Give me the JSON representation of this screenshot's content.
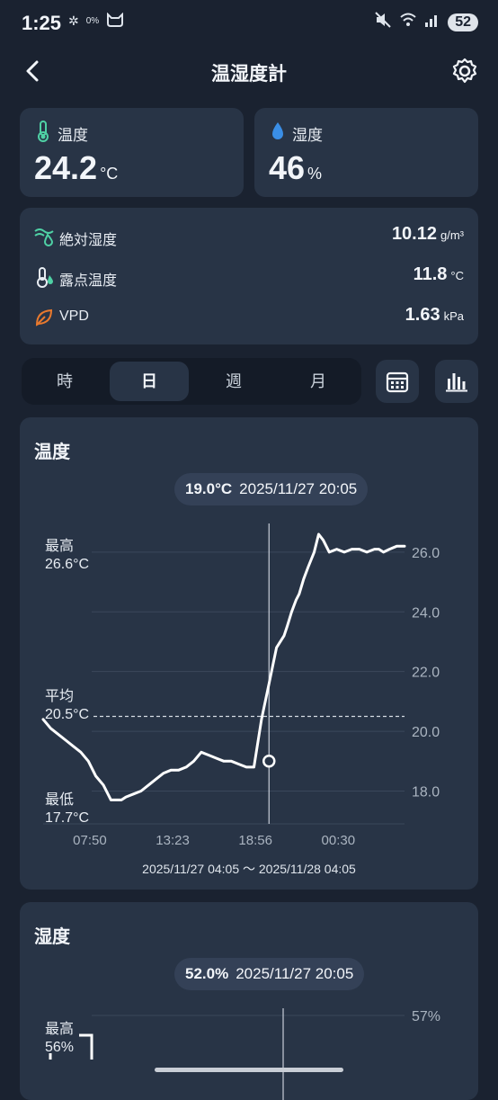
{
  "status": {
    "time": "1:25",
    "indicator": "0%",
    "battery": "52"
  },
  "appbar": {
    "title": "温湿度計"
  },
  "temp_card": {
    "label": "温度",
    "value": "24.2",
    "unit": "°C"
  },
  "hum_card": {
    "label": "湿度",
    "value": "46",
    "unit": "%"
  },
  "details": [
    {
      "label": "絶対湿度",
      "value": "10.12",
      "unit": "g/m³",
      "icon": "wind-water-icon"
    },
    {
      "label": "露点温度",
      "value": "11.8",
      "unit": "°C",
      "icon": "dew-point-icon"
    },
    {
      "label": "VPD",
      "value": "1.63",
      "unit": "kPa",
      "icon": "leaf-icon"
    }
  ],
  "tabs": [
    "時",
    "日",
    "週",
    "月"
  ],
  "active_tab": "日",
  "chart1": {
    "title": "温度",
    "pill_value": "19.0°C",
    "pill_time": "2025/11/27 20:05",
    "max_label": "最高",
    "max_value": "26.6°C",
    "avg_label": "平均",
    "avg_value": "20.5°C",
    "min_label": "最低",
    "min_value": "17.7°C",
    "range": "2025/11/27 04:05 ～ 2025/11/28 04:05"
  },
  "chart2": {
    "title": "湿度",
    "pill_value": "52.0%",
    "pill_time": "2025/11/27 20:05",
    "max_label": "最高",
    "max_value": "56%",
    "top_tick": "57%"
  },
  "chart_data": [
    {
      "type": "line",
      "title": "温度",
      "xlabel": "",
      "ylabel": "",
      "x_ticks": [
        "07:50",
        "13:23",
        "18:56",
        "00:30"
      ],
      "y_ticks": [
        "26.0",
        "24.0",
        "22.0",
        "20.0",
        "18.0"
      ],
      "ylim": [
        16.9,
        26.9
      ],
      "grid": true,
      "series": [
        {
          "x": [
            0,
            0.5,
            1,
            1.5,
            2,
            2.5,
            3,
            3.5,
            4,
            4.5,
            5,
            5.2,
            5.5,
            6,
            6.5,
            7,
            7.5,
            8,
            8.5,
            9,
            9.5,
            10,
            10.5,
            11,
            11.5,
            12,
            12.5,
            13,
            13.5,
            14,
            14.5,
            15,
            15.5,
            16,
            16.2,
            16.5,
            16.8,
            17,
            17.3,
            17.6,
            18,
            18.3,
            18.6,
            19,
            19.5,
            20,
            20.5,
            21,
            21.5,
            22,
            22.3,
            22.6,
            23,
            23.5,
            24
          ],
          "y": [
            20.4,
            20.1,
            19.9,
            19.7,
            19.5,
            19.3,
            19.0,
            18.5,
            18.2,
            17.7,
            17.7,
            17.7,
            17.8,
            17.9,
            18.0,
            18.2,
            18.4,
            18.6,
            18.7,
            18.7,
            18.8,
            19.0,
            19.3,
            19.2,
            19.1,
            19.0,
            19.0,
            18.9,
            18.8,
            18.8,
            20.4,
            21.6,
            22.8,
            23.2,
            23.5,
            24.0,
            24.4,
            24.6,
            25.1,
            25.5,
            26.0,
            26.6,
            26.4,
            26.0,
            26.1,
            26.0,
            26.1,
            26.1,
            26.0,
            26.1,
            26.1,
            26.0,
            26.1,
            26.2,
            26.2
          ]
        }
      ],
      "markers": {
        "max": 26.6,
        "avg": 20.5,
        "min": 17.7,
        "cursor": {
          "x": 15,
          "y": 19.0
        }
      }
    },
    {
      "type": "line",
      "title": "湿度",
      "y_ticks": [
        "57%"
      ],
      "series": [
        {
          "x": [
            0,
            0.4
          ],
          "y": [
            56,
            56
          ]
        }
      ]
    }
  ]
}
